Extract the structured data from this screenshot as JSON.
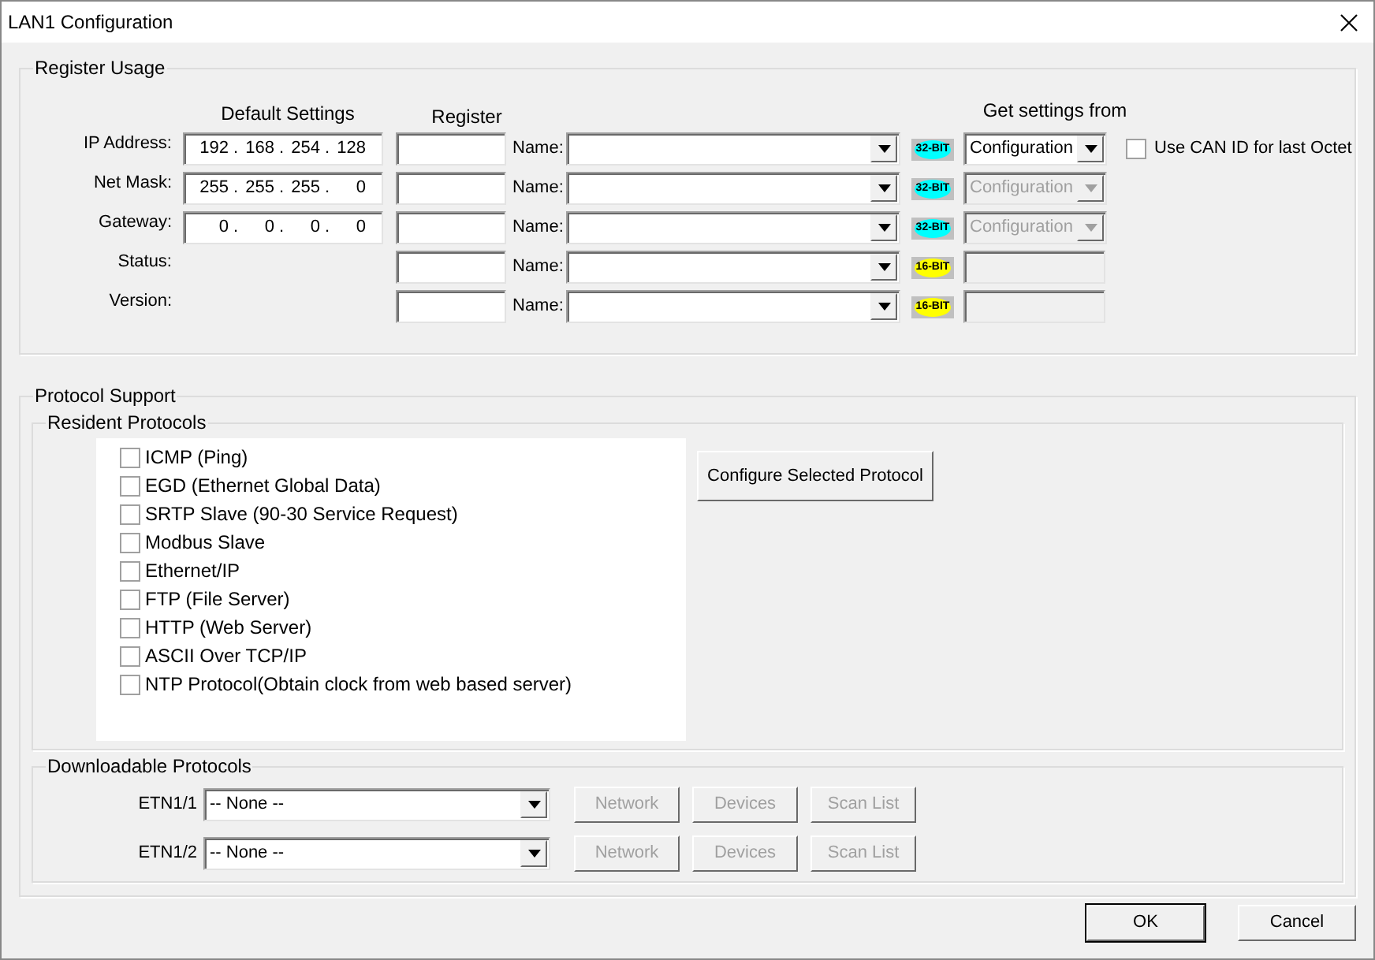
{
  "window": {
    "title": "LAN1 Configuration"
  },
  "register_usage": {
    "title": "Register Usage",
    "default_settings_header": "Default Settings",
    "register_header": "Register",
    "get_settings_header": "Get settings from",
    "ip_separator": ".",
    "rows": [
      {
        "label": "IP Address:",
        "octets": [
          "192",
          "168",
          "254",
          "128"
        ],
        "name_label": "Name:",
        "bits": "32-BIT",
        "color": "#00ffff",
        "source": "Configuration",
        "source_disabled": false
      },
      {
        "label": "Net Mask:",
        "octets": [
          "255",
          "255",
          "255",
          "0"
        ],
        "name_label": "Name:",
        "bits": "32-BIT",
        "color": "#00ffff",
        "source": "Configuration",
        "source_disabled": true
      },
      {
        "label": "Gateway:",
        "octets": [
          "0",
          "0",
          "0",
          "0"
        ],
        "name_label": "Name:",
        "bits": "32-BIT",
        "color": "#00ffff",
        "source": "Configuration",
        "source_disabled": true
      },
      {
        "label": "Status:",
        "name_label": "Name:",
        "bits": "16-BIT",
        "color": "#ffff00"
      },
      {
        "label": "Version:",
        "name_label": "Name:",
        "bits": "16-BIT",
        "color": "#ffff00"
      }
    ],
    "use_can_id": {
      "label": "Use CAN ID for last Octet",
      "checked": false
    }
  },
  "protocol_support": {
    "title": "Protocol Support",
    "resident": {
      "title": "Resident Protocols",
      "configure_button": "Configure Selected Protocol",
      "protocols": [
        {
          "label": "ICMP (Ping)",
          "checked": false
        },
        {
          "label": "EGD (Ethernet Global Data)",
          "checked": false
        },
        {
          "label": "SRTP Slave (90-30 Service Request)",
          "checked": false
        },
        {
          "label": "Modbus Slave",
          "checked": false
        },
        {
          "label": "Ethernet/IP",
          "checked": false
        },
        {
          "label": "FTP (File Server)",
          "checked": false
        },
        {
          "label": "HTTP (Web Server)",
          "checked": false
        },
        {
          "label": "ASCII Over TCP/IP",
          "checked": false
        },
        {
          "label": "NTP Protocol(Obtain clock from web based server)",
          "checked": false
        }
      ]
    },
    "downloadable": {
      "title": "Downloadable Protocols",
      "rows": [
        {
          "label": "ETN1/1",
          "value": "-- None --",
          "buttons": [
            {
              "label": "Network",
              "disabled": true
            },
            {
              "label": "Devices",
              "disabled": true
            },
            {
              "label": "Scan List",
              "disabled": true
            }
          ]
        },
        {
          "label": "ETN1/2",
          "value": "-- None --",
          "buttons": [
            {
              "label": "Network",
              "disabled": true
            },
            {
              "label": "Devices",
              "disabled": true
            },
            {
              "label": "Scan List",
              "disabled": true
            }
          ]
        }
      ]
    }
  },
  "footer_buttons": [
    {
      "label": "OK",
      "is_default": true
    },
    {
      "label": "Cancel",
      "is_default": false
    }
  ]
}
